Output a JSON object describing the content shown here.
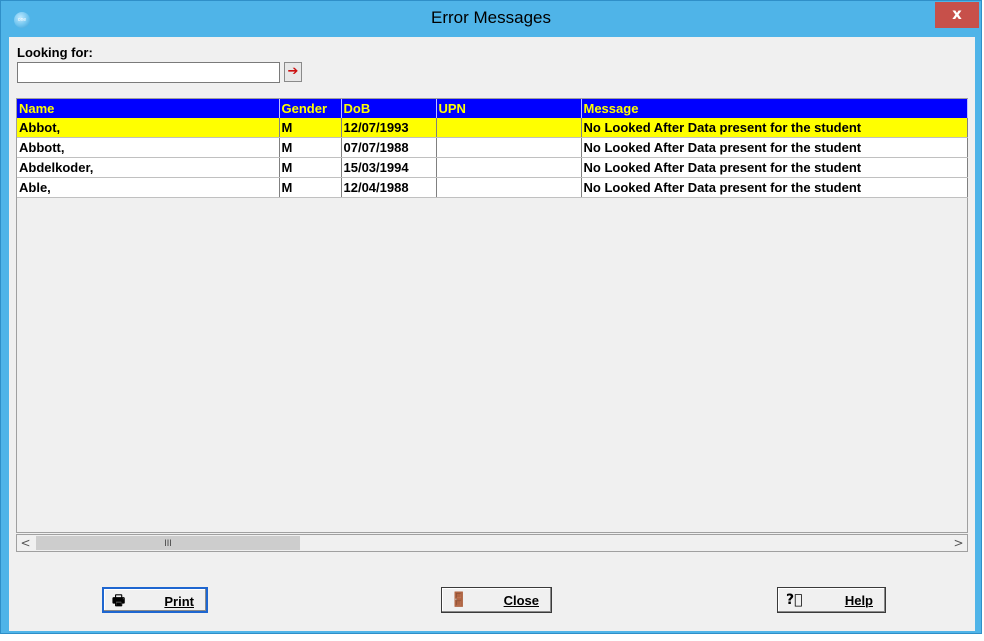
{
  "window": {
    "title": "Error Messages",
    "close_glyph": "x",
    "app_icon": "app-logo-icon",
    "app_icon_text": "one"
  },
  "search": {
    "label": "Looking for:",
    "value": "",
    "go_icon": "arrow-right-icon",
    "go_glyph": "➔"
  },
  "grid": {
    "columns": [
      "Name",
      "Gender",
      "DoB",
      "UPN",
      "Message"
    ],
    "rows": [
      {
        "name": "Abbot,",
        "gender": "M",
        "dob": "12/07/1993",
        "upn": "",
        "message": "No Looked After Data present for the student",
        "selected": true
      },
      {
        "name": "Abbott,",
        "gender": "M",
        "dob": "07/07/1988",
        "upn": "",
        "message": "No Looked After Data present for the student",
        "selected": false
      },
      {
        "name": "Abdelkoder,",
        "gender": "M",
        "dob": "15/03/1994",
        "upn": "",
        "message": "No Looked After Data present for the student",
        "selected": false
      },
      {
        "name": "Able,",
        "gender": "M",
        "dob": "12/04/1988",
        "upn": "",
        "message": "No Looked After Data present for the student",
        "selected": false
      }
    ],
    "colors": {
      "header_bg": "#0000ff",
      "header_text": "#ffff00",
      "selected_bg": "#ffff00"
    }
  },
  "scrollbar": {
    "left_arrow": "<",
    "right_arrow": ">",
    "thumb_grip": "III"
  },
  "buttons": {
    "print": {
      "label": "Print",
      "icon": "printer-icon",
      "glyph": "🖶"
    },
    "close": {
      "label": "Close",
      "icon": "door-exit-icon",
      "glyph": "🚪"
    },
    "help": {
      "label": "Help",
      "icon": "help-icon",
      "glyph": "?⃝"
    }
  },
  "colors": {
    "title_bar": "#4fb4e8",
    "close_button": "#c7504a"
  }
}
